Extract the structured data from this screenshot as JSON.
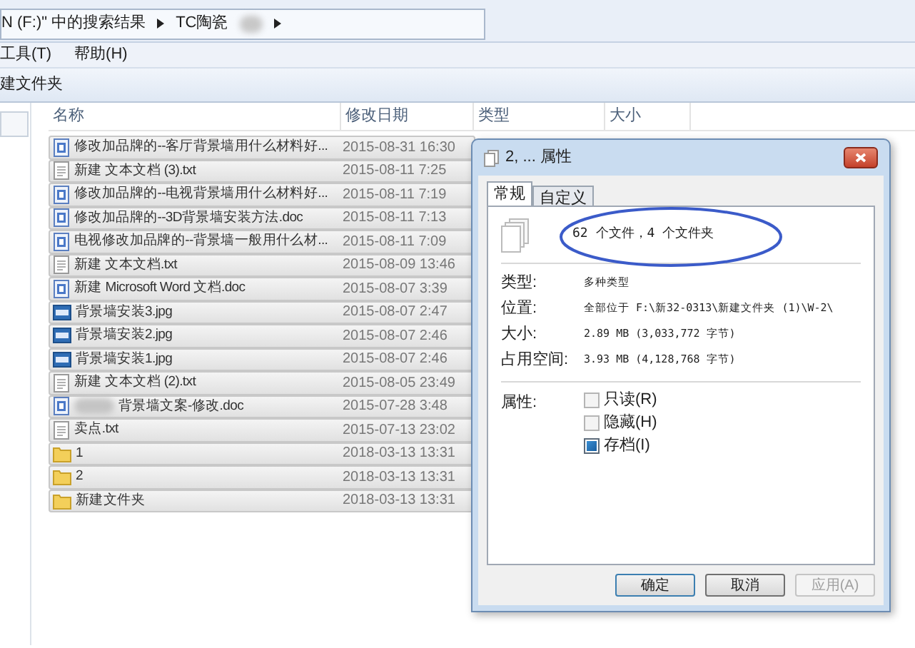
{
  "address_bar": {
    "crumbs": [
      {
        "label": "N (F:)\" 中的搜索结果"
      },
      {
        "label": "TC陶瓷"
      }
    ]
  },
  "menu_bar": [
    "工具(T)",
    "帮助(H)"
  ],
  "toolbar": {
    "new_folder": "建文件夹"
  },
  "columns": [
    "名称",
    "修改日期",
    "类型",
    "大小"
  ],
  "files": [
    {
      "kind": "word",
      "name": "修改加品牌的--客厅背景墙用什么材料好...",
      "date": "2015-08-31 16:30",
      "selected": true
    },
    {
      "kind": "txt",
      "name": "新建 文本文档 (3).txt",
      "date": "2015-08-11 7:25",
      "selected": true
    },
    {
      "kind": "word",
      "name": "修改加品牌的--电视背景墙用什么材料好...",
      "date": "2015-08-11 7:19",
      "selected": true
    },
    {
      "kind": "word",
      "name": "修改加品牌的--3D背景墙安装方法.doc",
      "date": "2015-08-11 7:13",
      "selected": true
    },
    {
      "kind": "word",
      "name": "电视修改加品牌的--背景墙一般用什么材...",
      "date": "2015-08-11 7:09",
      "selected": true
    },
    {
      "kind": "txt",
      "name": "新建 文本文档.txt",
      "date": "2015-08-09 13:46",
      "selected": true
    },
    {
      "kind": "word",
      "name": "新建 Microsoft Word 文档.doc",
      "date": "2015-08-07 3:39",
      "selected": true
    },
    {
      "kind": "jpg",
      "name": "背景墙安装3.jpg",
      "date": "2015-08-07 2:47",
      "selected": true
    },
    {
      "kind": "jpg",
      "name": "背景墙安装2.jpg",
      "date": "2015-08-07 2:46",
      "selected": true
    },
    {
      "kind": "jpg",
      "name": "背景墙安装1.jpg",
      "date": "2015-08-07 2:46",
      "selected": true
    },
    {
      "kind": "txt",
      "name": "新建 文本文档 (2).txt",
      "date": "2015-08-05 23:49",
      "selected": true
    },
    {
      "kind": "word",
      "name": "背景墙文案-修改.doc",
      "date": "2015-07-28 3:48",
      "selected": true,
      "blurred": true
    },
    {
      "kind": "txt",
      "name": "卖点.txt",
      "date": "2015-07-13 23:02",
      "selected": true
    },
    {
      "kind": "folder",
      "name": "1",
      "date": "2018-03-13 13:31",
      "selected": true
    },
    {
      "kind": "folder",
      "name": "2",
      "date": "2018-03-13 13:31",
      "selected": true
    },
    {
      "kind": "folder",
      "name": "新建文件夹",
      "date": "2018-03-13 13:31",
      "selected": true
    }
  ],
  "dialog": {
    "title": "2, ... 属性",
    "tabs": [
      {
        "label": "常规",
        "selected": true
      },
      {
        "label": "自定义",
        "selected": false
      }
    ],
    "summary": "62 个文件，4 个文件夹",
    "fields": [
      {
        "label": "类型:",
        "value": "多种类型"
      },
      {
        "label": "位置:",
        "value": "全部位于 F:\\新32-0313\\新建文件夹 (1)\\W-2\\"
      },
      {
        "label": "大小:",
        "value": "2.89 MB (3,033,772 字节)"
      },
      {
        "label": "占用空间:",
        "value": "3.93 MB (4,128,768 字节)"
      }
    ],
    "attributes_label": "属性:",
    "attributes": [
      {
        "label": "只读(R)",
        "checked": false
      },
      {
        "label": "隐藏(H)",
        "checked": false
      },
      {
        "label": "存档(I)",
        "checked": true
      }
    ],
    "buttons": [
      {
        "label": "确定",
        "disabled": false
      },
      {
        "label": "取消",
        "disabled": false
      },
      {
        "label": "应用(A)",
        "disabled": true
      }
    ]
  }
}
